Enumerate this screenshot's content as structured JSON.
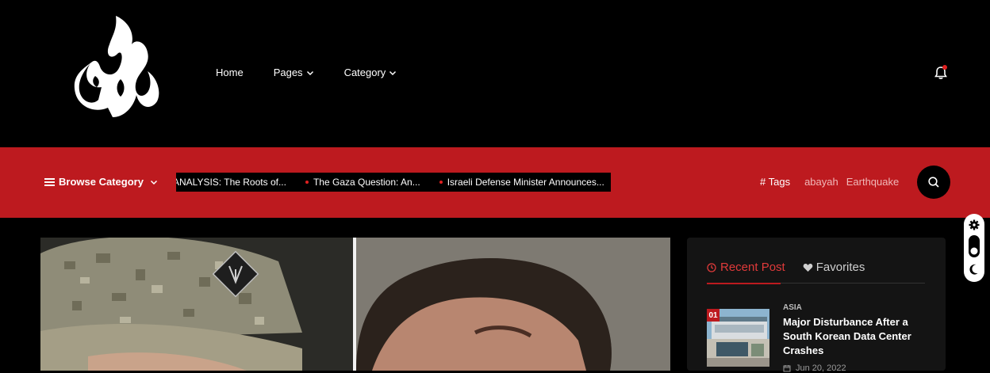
{
  "nav": {
    "items": [
      {
        "label": "Home",
        "has_dropdown": false
      },
      {
        "label": "Pages",
        "has_dropdown": true
      },
      {
        "label": "Category",
        "has_dropdown": true
      }
    ]
  },
  "header": {
    "logo_icon": "calligraphy-logo",
    "notification_icon": "bell-icon"
  },
  "subbar": {
    "browse_label": "Browse Category",
    "ticker": [
      "ANALYSIS: The Roots of...",
      "The Gaza Question: An...",
      "Israeli Defense Minister Announces..."
    ],
    "tags_label": "# Tags",
    "tags": [
      "abayah",
      "Earthquake"
    ],
    "search_icon": "search-icon"
  },
  "sidebar": {
    "tabs": [
      {
        "label": "Recent Post",
        "icon": "clock-icon",
        "active": true
      },
      {
        "label": "Favorites",
        "icon": "heart-icon",
        "active": false
      }
    ],
    "posts": [
      {
        "number": "01",
        "category": "ASIA",
        "title": "Major Disturbance After a South Korean Data Center Crashes",
        "date": "Jun 20, 2022"
      }
    ]
  },
  "colors": {
    "brand_red": "#bd1a1f",
    "background": "#000000",
    "accent_text": "#e03a3a"
  }
}
